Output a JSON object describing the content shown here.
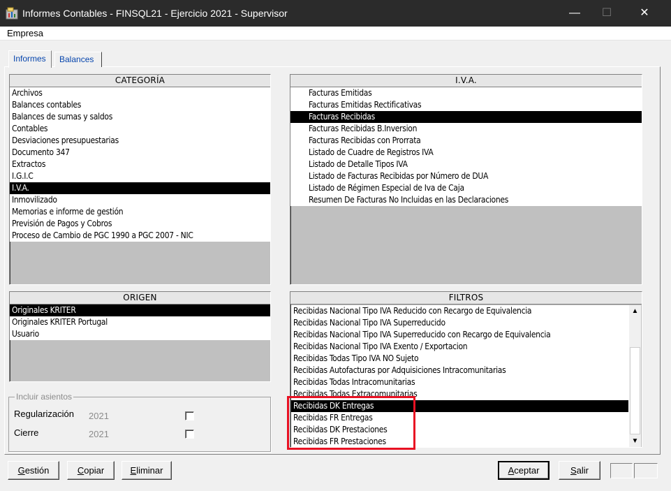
{
  "window": {
    "title": "Informes Contables - FINSQL21 - Ejercicio 2021 - Supervisor",
    "minimize_glyph": "—",
    "maximize_glyph": "☐",
    "close_glyph": "✕"
  },
  "menu": {
    "items": [
      "Empresa"
    ]
  },
  "tabs": [
    {
      "label": "Informes",
      "active": true
    },
    {
      "label": "Balances",
      "active": false
    }
  ],
  "categoria": {
    "header": "CATEGORÍA",
    "items": [
      "Archivos",
      "Balances contables",
      "Balances de sumas y saldos",
      "Contables",
      "Desviaciones presupuestarias",
      "Documento 347",
      "Extractos",
      "I.G.I.C",
      "I.V.A.",
      "Inmovilizado",
      "Memorias e informe de gestión",
      "Previsión de Pagos y Cobros",
      "Proceso de Cambio de PGC 1990 a PGC 2007 - NIC"
    ],
    "selected_index": 8
  },
  "iva": {
    "header": "I.V.A.",
    "items": [
      "Facturas Emitidas",
      "Facturas Emitidas Rectificativas",
      "Facturas Recibidas",
      "Facturas Recibidas B.Inversion",
      "Facturas Recibidas con Prorrata",
      "Listado de Cuadre de Registros IVA",
      "Listado de Detalle Tipos IVA",
      "Listado de Facturas Recibidas por Número de DUA",
      "Listado de Régimen Especial de Iva de Caja",
      "Resumen De Facturas No Incluidas en las Declaraciones"
    ],
    "selected_index": 2
  },
  "origen": {
    "header": "ORIGEN",
    "items": [
      "Originales KRITER",
      "Originales KRITER Portugal",
      "Usuario"
    ],
    "selected_index": 0
  },
  "filtros": {
    "header": "FILTROS",
    "items": [
      "Recibidas Nacional Tipo IVA Reducido con Recargo de Equivalencia",
      "Recibidas Nacional Tipo IVA Superreducido",
      "Recibidas Nacional Tipo IVA Superreducido con Recargo de Equivalencia",
      "Recibidas Nacional Tipo IVA Exento / Exportacion",
      "Recibidas Todas Tipo IVA NO Sujeto",
      "Recibidas Autofacturas por Adquisiciones Intracomunitarias",
      "Recibidas Todas Intracomunitarias",
      "Recibidas Todas Extracomunitarias",
      "Recibidas DK Entregas",
      "Recibidas FR Entregas",
      "Recibidas DK Prestaciones",
      "Recibidas FR Prestaciones"
    ],
    "selected_index": 8,
    "scroll_up_glyph": "▲",
    "scroll_down_glyph": "▼"
  },
  "incluir_asientos": {
    "legend": "Incluir asientos",
    "rows": [
      {
        "label": "Regularización",
        "year": "2021",
        "checked": false
      },
      {
        "label": "Cierre",
        "year": "2021",
        "checked": false
      }
    ]
  },
  "buttons": {
    "gestion": "Gestión",
    "copiar": "Copiar",
    "eliminar": "Eliminar",
    "aceptar": "Aceptar",
    "salir": "Salir"
  },
  "colors": {
    "titlebar": "#2b2b2b",
    "selection": "#000000",
    "tab_text": "#0645ad",
    "highlight_annotation": "#e81123"
  },
  "icons": {
    "app": "folder-report-icon",
    "minimize": "minimize-icon",
    "maximize": "maximize-icon",
    "close": "close-icon"
  }
}
